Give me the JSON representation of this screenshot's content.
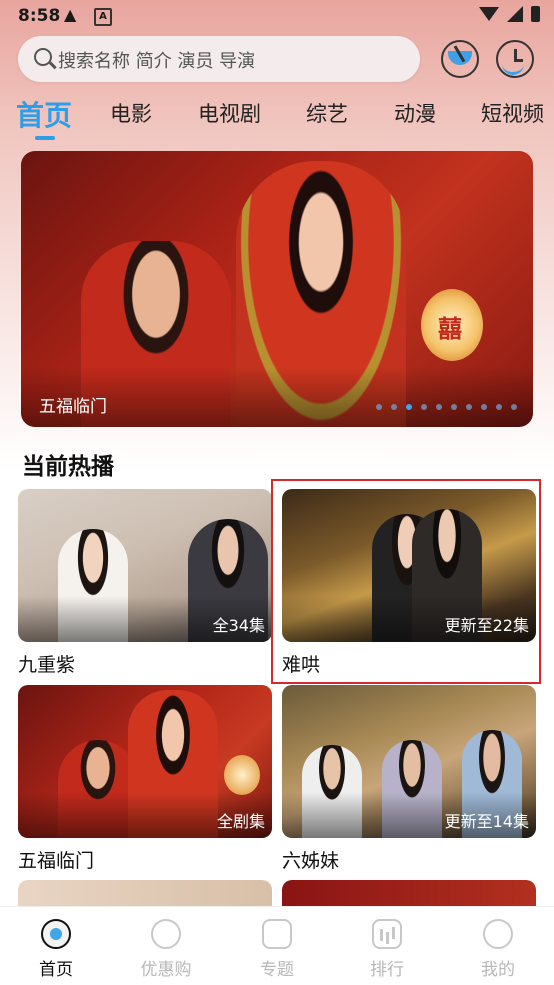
{
  "status_bar": {
    "time": "8:58",
    "warning_icon": "warning-icon",
    "a_icon": "A",
    "icons": [
      "wifi-icon",
      "signal-icon",
      "battery-icon"
    ]
  },
  "search": {
    "placeholder": "搜索名称 简介 演员 导演",
    "download_icon": "download-icon",
    "history_icon": "history-icon"
  },
  "tabs": [
    {
      "label": "首页",
      "active": true
    },
    {
      "label": "电影",
      "active": false
    },
    {
      "label": "电视剧",
      "active": false
    },
    {
      "label": "综艺",
      "active": false
    },
    {
      "label": "动漫",
      "active": false
    },
    {
      "label": "短视频",
      "active": false
    }
  ],
  "banner": {
    "caption": "五福临门",
    "lantern_text": "囍",
    "dot_count": 10,
    "active_dot_index": 2
  },
  "section": {
    "title": "当前热播"
  },
  "cards": [
    {
      "title": "九重紫",
      "badge": "全34集"
    },
    {
      "title": "难哄",
      "badge": "更新至22集"
    },
    {
      "title": "五福临门",
      "badge": "全剧集"
    },
    {
      "title": "六姊妹",
      "badge": "更新至14集"
    }
  ],
  "bottom_nav": [
    {
      "label": "首页",
      "icon": "home-icon",
      "active": true
    },
    {
      "label": "优惠购",
      "icon": "discount-icon",
      "active": false
    },
    {
      "label": "专题",
      "icon": "topic-icon",
      "active": false
    },
    {
      "label": "排行",
      "icon": "ranking-icon",
      "active": false
    },
    {
      "label": "我的",
      "icon": "profile-icon",
      "active": false
    }
  ],
  "colors": {
    "accent": "#2e9ee8",
    "highlight_border": "#d7282d"
  }
}
